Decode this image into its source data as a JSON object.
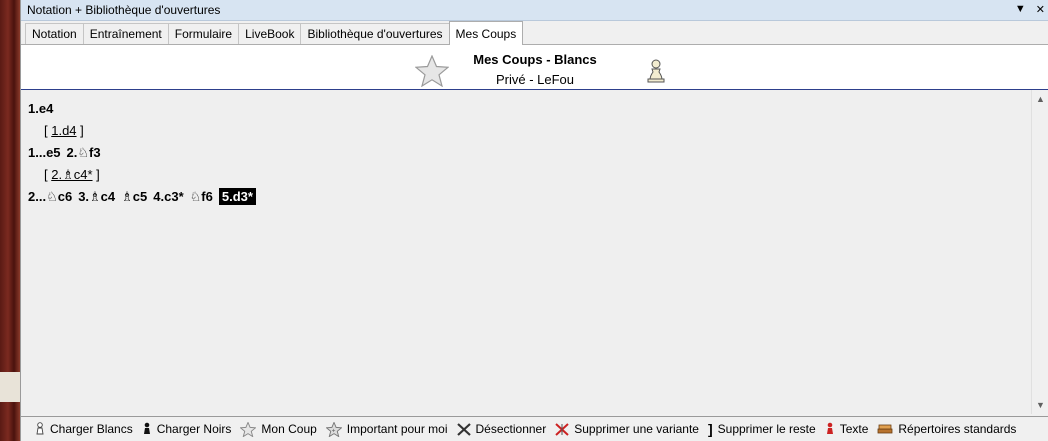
{
  "window": {
    "title": "Notation + Bibliothèque d'ouvertures"
  },
  "tabs": [
    {
      "label": "Notation"
    },
    {
      "label": "Entraînement"
    },
    {
      "label": "Formulaire"
    },
    {
      "label": "LiveBook"
    },
    {
      "label": "Bibliothèque d'ouvertures"
    },
    {
      "label": "Mes Coups"
    }
  ],
  "header": {
    "title": "Mes Coups - Blancs",
    "subtitle": "Privé - LeFou"
  },
  "notation": {
    "l1": "1.e4",
    "var1": "1.d4",
    "l2a": "1...e5",
    "l2b": "2.♘f3",
    "var2": "2.♗c4*",
    "l3a": "2...♘c6",
    "l3b": "3.♗c4",
    "l3c": "♗c5",
    "l3d": "4.c3*",
    "l3e": "♘f6",
    "current": "5.d3*"
  },
  "toolbar": {
    "load_white": "Charger Blancs",
    "load_black": "Charger Noirs",
    "my_move": "Mon Coup",
    "important": "Important pour moi",
    "deselect": "Désectionner",
    "delete_variation": "Supprimer une variante",
    "delete_rest": "Supprimer le reste",
    "text": "Texte",
    "standard_reps": "Répertoires standards"
  }
}
